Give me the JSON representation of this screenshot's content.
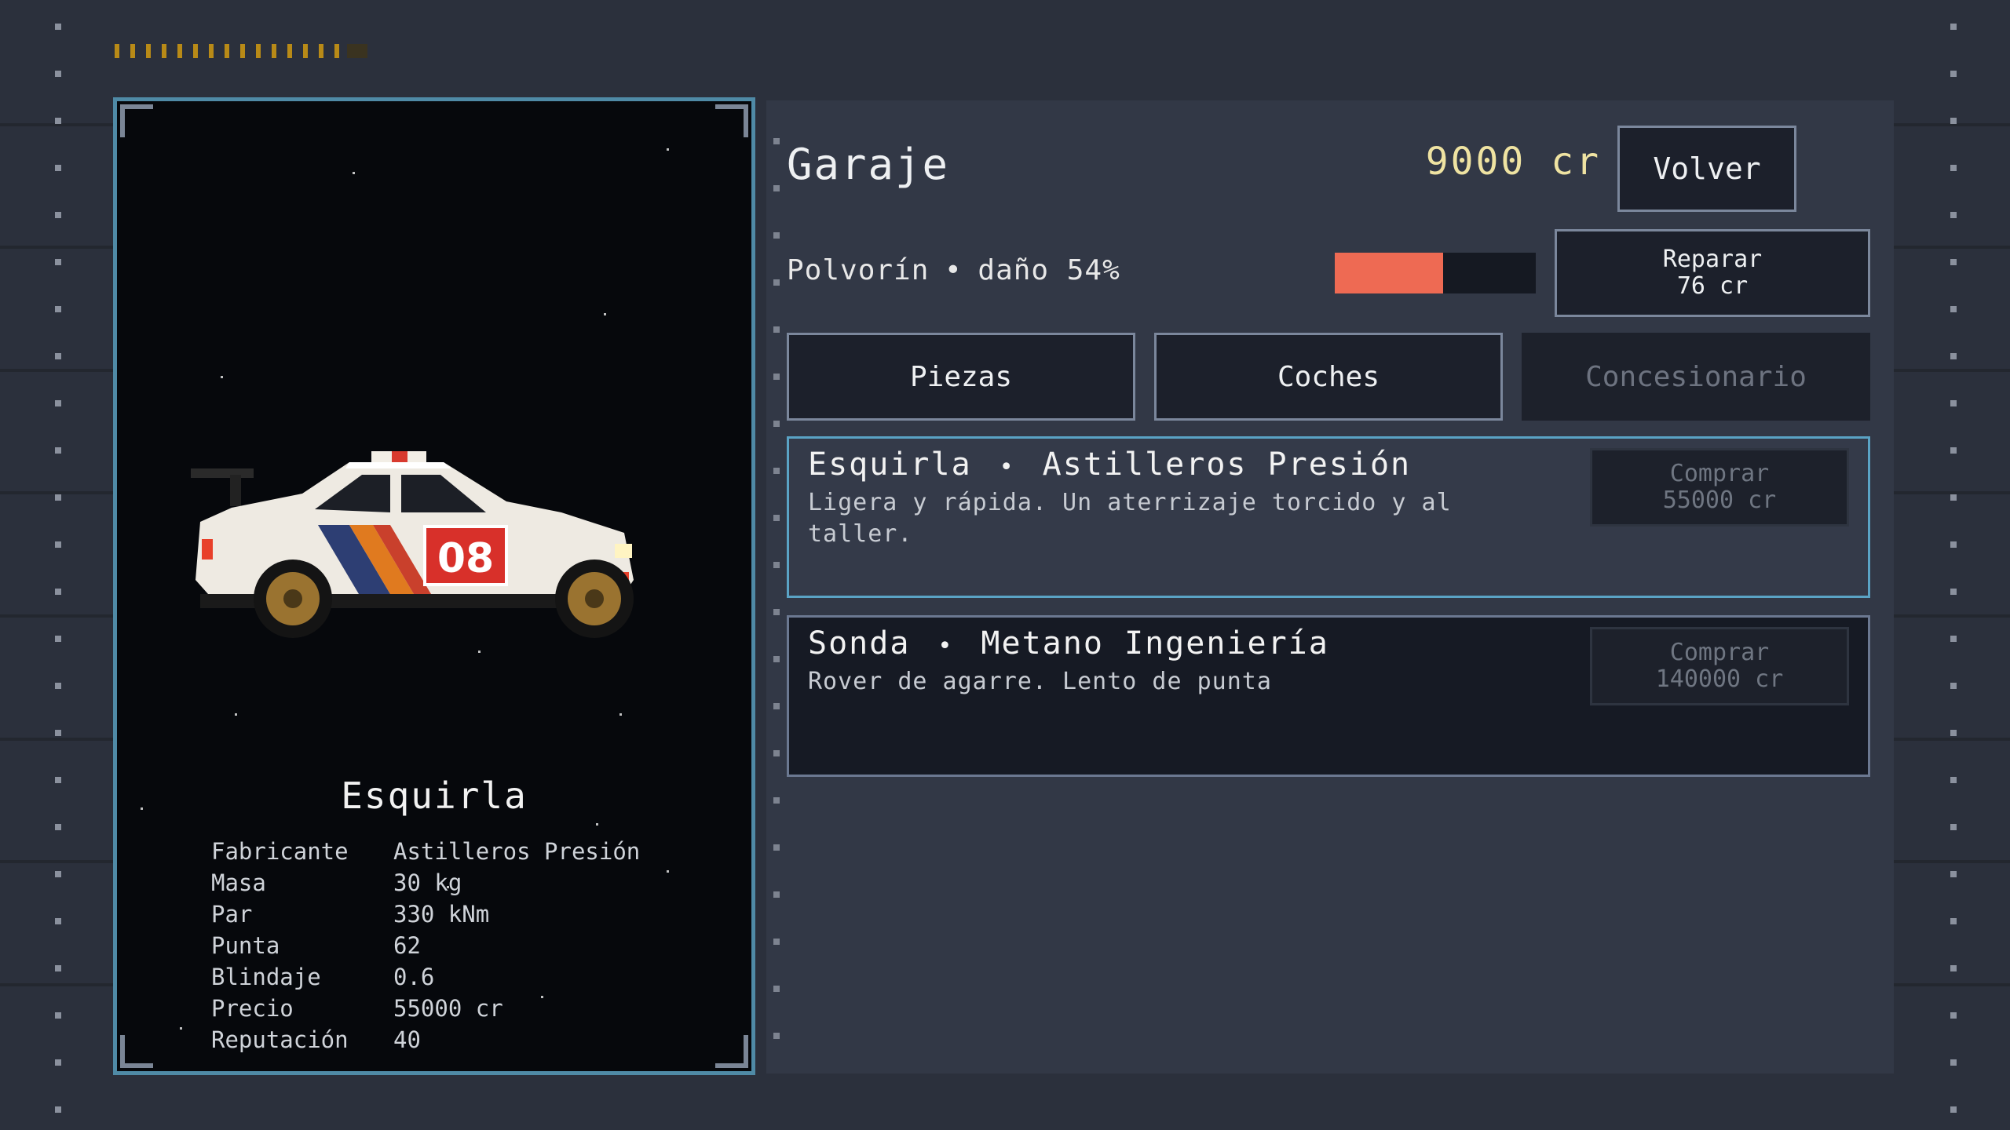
{
  "header": {
    "title": "Garaje",
    "credits": "9000 cr",
    "back_label": "Volver"
  },
  "status": {
    "car": "Polvorín",
    "separator": "•",
    "damage_text": "daño 54%",
    "damage_fraction": 0.54,
    "damage_color": "#ee6a53"
  },
  "repair": {
    "label": "Reparar",
    "cost": "76 cr"
  },
  "tabs": [
    {
      "label": "Piezas",
      "active": false
    },
    {
      "label": "Coches",
      "active": false
    },
    {
      "label": "Concesionario",
      "active": true
    }
  ],
  "listings": [
    {
      "name": "Esquirla",
      "separator": "•",
      "maker": "Astilleros Presión",
      "description": "Ligera y rápida. Un aterrizaje torcido y al taller.",
      "buy_label": "Comprar",
      "price": "55000 cr",
      "selected": true
    },
    {
      "name": "Sonda",
      "separator": "•",
      "maker": "Metano Ingeniería",
      "description": "Rover de agarre. Lento de punta",
      "buy_label": "Comprar",
      "price": "140000 cr",
      "selected": false
    }
  ],
  "preview": {
    "name": "Esquirla",
    "car_number": "08",
    "stats": [
      {
        "label": "Fabricante",
        "value": "Astilleros Presión"
      },
      {
        "label": "Masa",
        "value": "30 kg"
      },
      {
        "label": "Par",
        "value": "330 kNm"
      },
      {
        "label": "Punta",
        "value": "62"
      },
      {
        "label": "Blindaje",
        "value": "0.6"
      },
      {
        "label": "Precio",
        "value": "55000 cr"
      },
      {
        "label": "Reputación",
        "value": "40"
      }
    ]
  },
  "colors": {
    "accent": "#4f8aa6",
    "credits": "#efe3a2",
    "panel": "#323846",
    "background": "#2b303c"
  }
}
